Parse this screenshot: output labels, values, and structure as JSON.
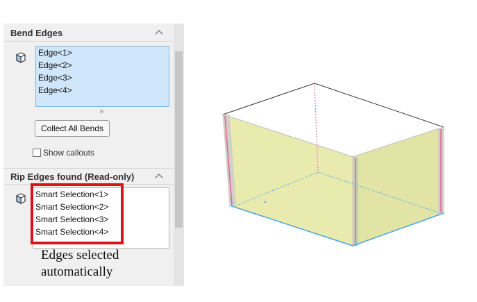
{
  "bend_edges": {
    "title": "Bend Edges",
    "items": [
      "Edge<1>",
      "Edge<2>",
      "Edge<3>",
      "Edge<4>"
    ],
    "collect_button": "Collect All Bends",
    "show_callouts_label": "Show callouts",
    "show_callouts_checked": false
  },
  "rip_edges": {
    "title": "Rip Edges found (Read-only)",
    "items": [
      "Smart Selection<1>",
      "Smart Selection<2>",
      "Smart Selection<3>",
      "Smart Selection<4>"
    ]
  },
  "annotation": {
    "line1": "Edges selected",
    "line2": "automatically",
    "color": "#d9131b"
  },
  "colors": {
    "panel_bg": "#f0f0f0",
    "selected_list_bg": "#cfe6fb",
    "model_fill": "#eef0b8",
    "bend_line": "#e05fa0",
    "rip_line": "#4aa3e8"
  },
  "icons": {
    "section_collapse": "chevron-up-icon",
    "edge_selector": "cube-edge-icon"
  }
}
